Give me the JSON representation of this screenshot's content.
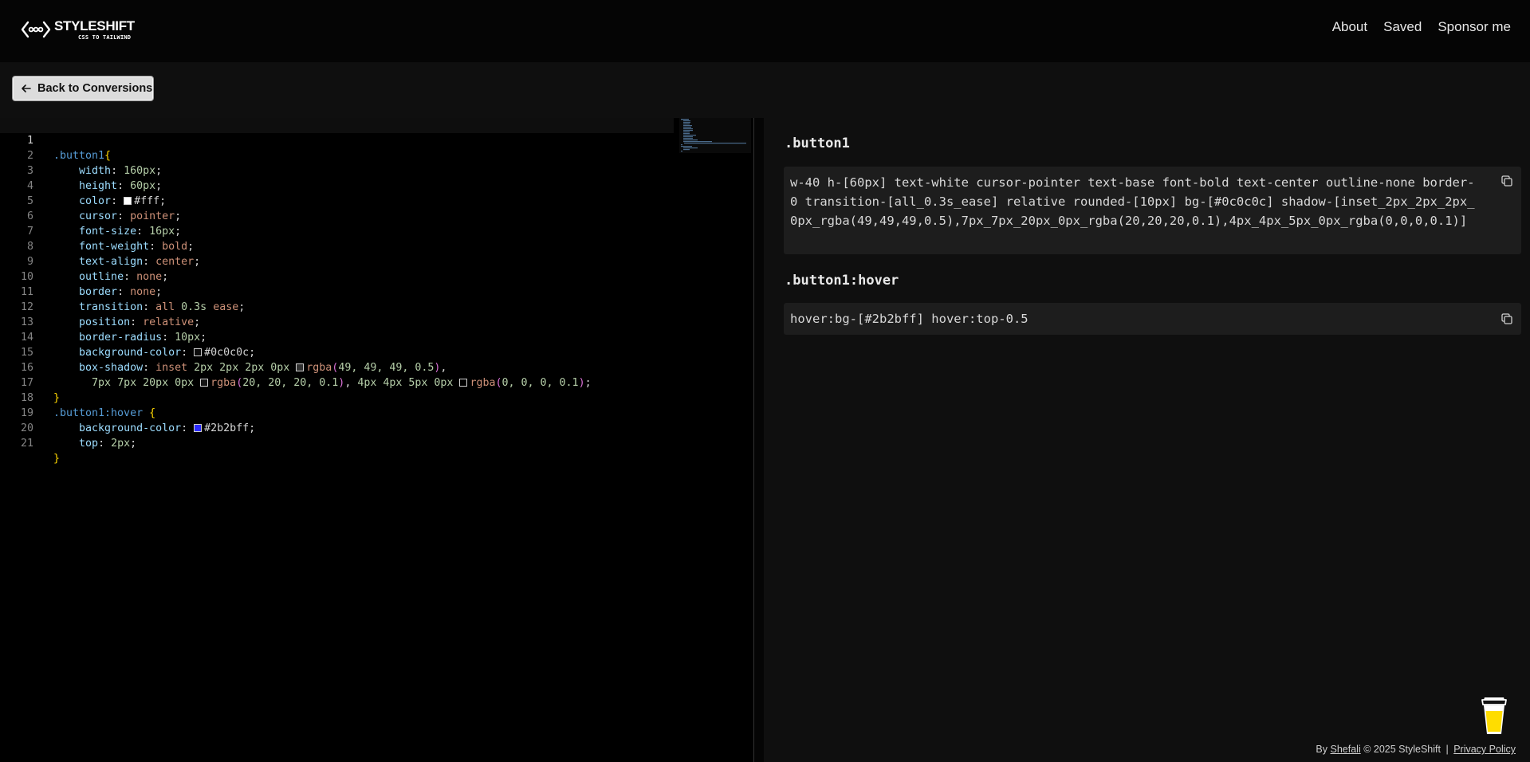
{
  "brand": {
    "name": "STYLESHIFT",
    "tagline": "CSS TO TAILWIND"
  },
  "nav": {
    "links": [
      "About",
      "Saved",
      "Sponsor me"
    ]
  },
  "toolbar": {
    "back_label": "Back to Conversions"
  },
  "editor": {
    "line_numbers": [
      "1",
      "2",
      "3",
      "4",
      "5",
      "6",
      "7",
      "8",
      "9",
      "10",
      "11",
      "12",
      "13",
      "14",
      "15",
      "16",
      "17",
      "18",
      "19",
      "20",
      "21"
    ],
    "swatch_colors": {
      "white": "#ffffff",
      "dark": "#0c0c0c",
      "blue": "#2b2bff"
    }
  },
  "output": {
    "blocks": [
      {
        "selector": ".button1",
        "classes": "w-40 h-[60px] text-white cursor-pointer text-base font-bold text-center outline-none border-0 transition-[all_0.3s_ease] relative rounded-[10px] bg-[#0c0c0c] shadow-[inset_2px_2px_2px_0px_rgba(49,49,49,0.5),7px_7px_20px_0px_rgba(20,20,20,0.1),4px_4px_5px_0px_rgba(0,0,0,0.1)]"
      },
      {
        "selector": ".button1:hover",
        "classes": "hover:bg-[#2b2bff] hover:top-0.5"
      }
    ]
  },
  "footer": {
    "by": "By",
    "author": "Shefali",
    "copyright": "© 2025 StyleShift",
    "separator": "|",
    "privacy": "Privacy Policy"
  },
  "colors": {
    "accent_swatch": "#2b2bff",
    "bmc_cup": "#ffdd00"
  }
}
